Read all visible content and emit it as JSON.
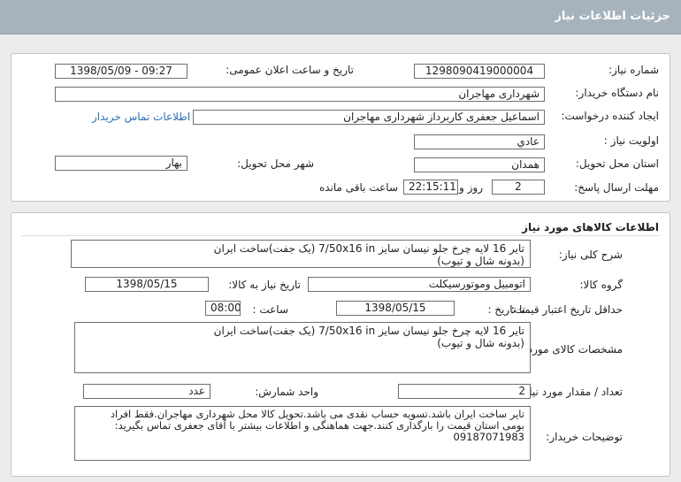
{
  "header": {
    "title": "جزئیات اطلاعات نیاز"
  },
  "info": {
    "need_number_label": "شماره نیاز:",
    "need_number": "1298090419000004",
    "announce_label": "تاریخ و ساعت اعلان عمومی:",
    "announce_value": "1398/05/09 - 09:27",
    "buyer_label": "نام دستگاه خریدار:",
    "buyer_value": "شهرداری مهاجران",
    "creator_label": "ایجاد کننده درخواست:",
    "creator_value": "اسماعیل جعفری کاربرداز شهرداری مهاجران",
    "contact_link": "اطلاعات تماس خریدار",
    "priority_label": "اولویت نیاز :",
    "priority_value": "عادي",
    "province_label": "استان محل تحویل:",
    "province_value": "همدان",
    "city_label": "شهر محل تحویل:",
    "city_value": "بهار",
    "deadline_label": "مهلت ارسال پاسخ:",
    "deadline_days": "2",
    "days_word": "روز و",
    "deadline_time": "22:15:11",
    "remaining_word": "ساعت باقی مانده"
  },
  "goods": {
    "section_title": "اطلاعات کالاهای مورد نیاز",
    "desc_label": "شرح کلی نیاز:",
    "desc_line1": "تایر 16 لایه چرخ جلو نیسان سایز 7/50x16 in (یک جفت)ساخت ایران",
    "desc_line2": "(بدونه شال و تیوب)",
    "group_label": "گروه کالا:",
    "group_value": "اتومبیل وموتورسیکلت",
    "need_date_label": "تاریخ نیاز به کالا:",
    "need_date_value": "1398/05/15",
    "min_valid_label": "حداقل تاریخ اعتبار قیمت:",
    "until_date_label": "تا تاریخ :",
    "until_date_value": "1398/05/15",
    "hour_label": "ساعت :",
    "hour_value": "08:00",
    "spec_label": "مشخصات کالای مورد نیاز:",
    "spec_line1": "تایر 16 لایه چرخ جلو نیسان سایز 7/50x16 in (یک جفت)ساخت ایران",
    "spec_line2": "(بدونه شال و تیوب)",
    "qty_label": "تعداد / مقدار مورد نیاز:",
    "qty_value": "2",
    "unit_label": "واحد شمارش:",
    "unit_value": "عدد",
    "buyer_notes_label": "توضیحات خریدار:",
    "notes_line1": "تایر ساخت ایران باشد.تسویه حساب نقدی می باشد.تحویل کالا محل شهرداری مهاجران.فقط افراد",
    "notes_line2": "بومی استان قیمت را بارگذاری کنند.جهت هماهنگی و اطلاعات بیشتر با آقای جعفری تماس بگیرید:",
    "notes_line3": "09187071983"
  },
  "colors": {
    "titlebar": "#a6b3bd",
    "link": "#2d6fb5"
  }
}
